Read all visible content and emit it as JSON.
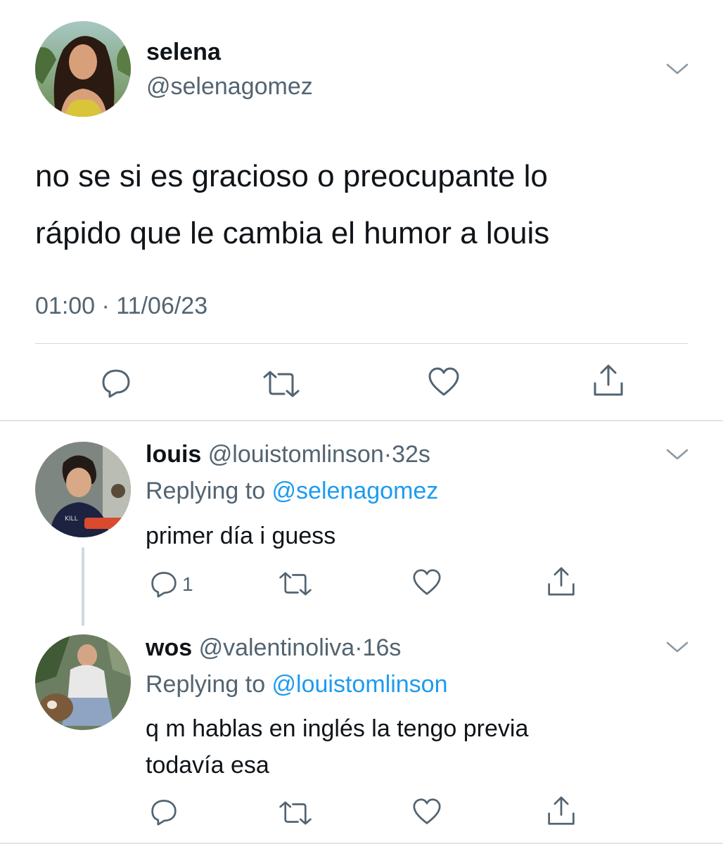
{
  "main_tweet": {
    "name": "selena",
    "handle": "@selenagomez",
    "text_line1": "no se si es gracioso o preocupante lo",
    "text_line2": "rápido que le cambia el humor a louis",
    "timestamp": "01:00 · 11/06/23",
    "actions": [
      "reply-icon",
      "retweet-icon",
      "like-icon",
      "share-icon"
    ]
  },
  "replies": [
    {
      "name": "louis",
      "handle": "@louistomlinson",
      "separator": "·",
      "time": "32s",
      "replying_prefix": "Replying to ",
      "replying_to": "@selenagomez",
      "text": "primer día i guess",
      "reply_count": "1"
    },
    {
      "name": "wos",
      "handle": "@valentinoliva",
      "separator": "·",
      "time": "16s",
      "replying_prefix": "Replying to ",
      "replying_to": "@louistomlinson",
      "text_line1": "q m hablas en inglés la tengo previa",
      "text_line2": "todavía esa"
    }
  ],
  "colors": {
    "text": "#0f1419",
    "secondary": "#536471",
    "link": "#1d9bf0",
    "divider": "#cfd9de"
  }
}
